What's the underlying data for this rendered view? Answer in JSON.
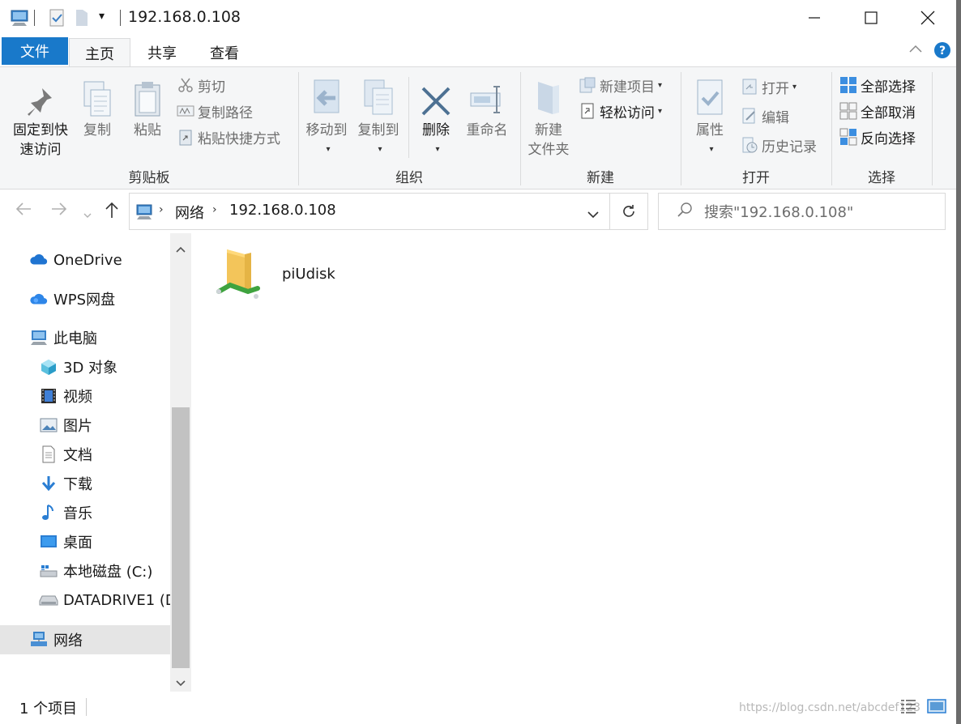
{
  "window": {
    "title": "192.168.0.108",
    "qat_dropdown_glyph": "▾"
  },
  "tabs": [
    {
      "label": "文件"
    },
    {
      "label": "主页"
    },
    {
      "label": "共享"
    },
    {
      "label": "查看"
    }
  ],
  "ribbon": {
    "clipboard": {
      "pin_line1": "固定到快",
      "pin_line2": "速访问",
      "copy": "复制",
      "paste": "粘贴",
      "cut": "剪切",
      "copy_path": "复制路径",
      "paste_shortcut": "粘贴快捷方式",
      "group": "剪贴板"
    },
    "organize": {
      "move_to": "移动到",
      "copy_to": "复制到",
      "delete": "删除",
      "rename": "重命名",
      "group": "组织"
    },
    "new": {
      "new_item": "新建项目",
      "easy_access": "轻松访问",
      "new_folder_line1": "新建",
      "new_folder_line2": "文件夹",
      "group": "新建"
    },
    "open": {
      "properties": "属性",
      "open": "打开",
      "edit": "编辑",
      "history": "历史记录",
      "group": "打开"
    },
    "select": {
      "select_all": "全部选择",
      "select_none": "全部取消",
      "invert": "反向选择",
      "group": "选择"
    }
  },
  "address": {
    "crumbs": [
      "网络",
      "192.168.0.108"
    ],
    "search_placeholder": "搜索\"192.168.0.108\""
  },
  "navpane": {
    "items": [
      {
        "label": "OneDrive"
      },
      {
        "label": "WPS网盘"
      },
      {
        "label": "此电脑"
      },
      {
        "label": "3D 对象"
      },
      {
        "label": "视频"
      },
      {
        "label": "图片"
      },
      {
        "label": "文档"
      },
      {
        "label": "下载"
      },
      {
        "label": "音乐"
      },
      {
        "label": "桌面"
      },
      {
        "label": "本地磁盘 (C:)"
      },
      {
        "label": "DATADRIVE1 (D"
      },
      {
        "label": "网络"
      }
    ]
  },
  "content": {
    "items": [
      {
        "name": "piUdisk"
      }
    ]
  },
  "status": {
    "count": "1 个项目",
    "watermark": "https://blog.csdn.net/abcdef123"
  },
  "colors": {
    "accent": "#1979ca",
    "ribbon_bg": "#f5f6f7",
    "selected_nav": "#e5e5e5"
  }
}
